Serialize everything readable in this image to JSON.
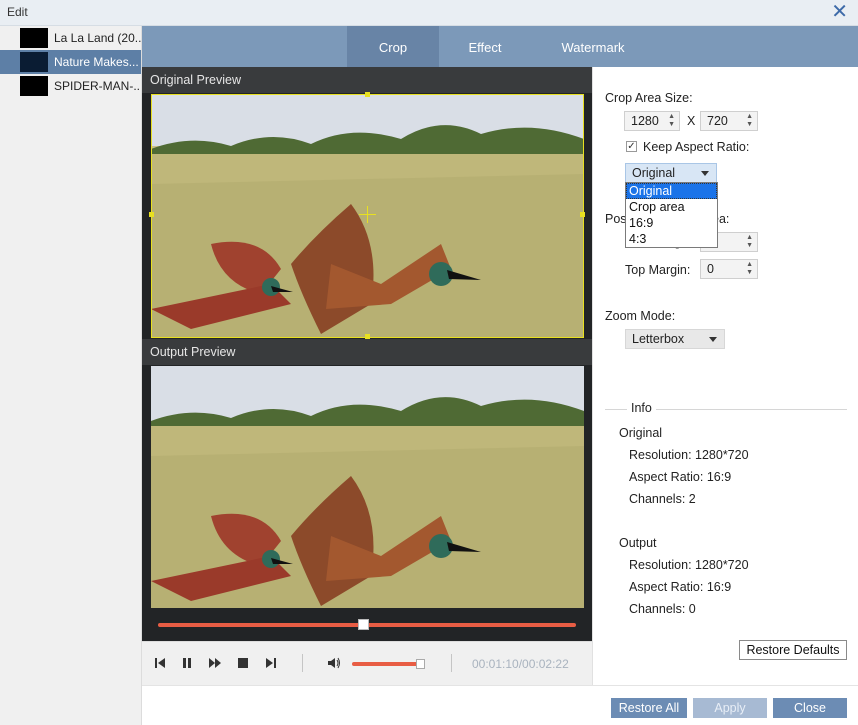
{
  "window": {
    "title": "Edit",
    "close_icon": "close-icon"
  },
  "files": [
    {
      "name": "La La Land (20...",
      "selected": false
    },
    {
      "name": "Nature Makes...",
      "selected": true
    },
    {
      "name": "SPIDER-MAN-...",
      "selected": false
    }
  ],
  "tabs": [
    {
      "label": "Crop",
      "active": true
    },
    {
      "label": "Effect",
      "active": false
    },
    {
      "label": "Watermark",
      "active": false
    }
  ],
  "preview": {
    "original_label": "Original Preview",
    "output_label": "Output Preview",
    "seek_fraction": 0.49,
    "volume_fraction": 0.95,
    "timecode": "00:01:10/00:02:22"
  },
  "crop": {
    "area_size_label": "Crop Area Size:",
    "width": "1280",
    "x_label": "X",
    "height": "720",
    "keep_aspect_label": "Keep Aspect Ratio:",
    "keep_aspect_checked": true,
    "aspect_selected": "Original",
    "aspect_options": [
      "Original",
      "Crop area",
      "16:9",
      "4:3"
    ],
    "position_label_visible": "Pos",
    "position_label_tail": "ea:",
    "left_margin_tail": "g",
    "top_margin_label": "Top Margin:",
    "top_margin_value": "0",
    "zoom_mode_label": "Zoom Mode:",
    "zoom_mode_value": "Letterbox"
  },
  "info": {
    "title": "Info",
    "original": {
      "heading": "Original",
      "resolution": "Resolution: 1280*720",
      "aspect": "Aspect Ratio: 16:9",
      "channels": "Channels: 2"
    },
    "output": {
      "heading": "Output",
      "resolution": "Resolution: 1280*720",
      "aspect": "Aspect Ratio: 16:9",
      "channels": "Channels: 0"
    }
  },
  "buttons": {
    "restore_defaults": "Restore Defaults",
    "restore_all": "Restore All",
    "apply": "Apply",
    "close": "Close"
  },
  "colors": {
    "accent": "#e85d44",
    "tabbar": "#7c99b9",
    "crop_border": "#e8e020"
  }
}
